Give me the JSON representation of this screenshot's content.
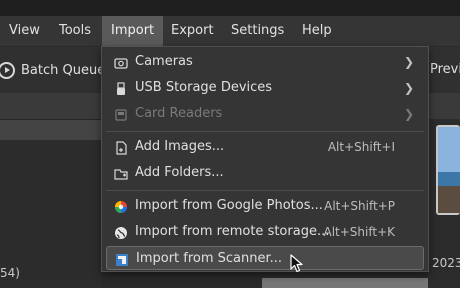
{
  "menubar": {
    "items": [
      "View",
      "Tools",
      "Import",
      "Export",
      "Settings",
      "Help"
    ],
    "active": "Import"
  },
  "toolbar": {
    "batch_queue_label": "Batch Queue",
    "preview_label": "Previ"
  },
  "left_panel": {
    "bottom_text": "54)"
  },
  "right_panel": {
    "date_text": "2023"
  },
  "import_menu": {
    "items": [
      {
        "label": "Cameras",
        "icon": "camera-icon",
        "submenu": true,
        "enabled": true
      },
      {
        "label": "USB Storage Devices",
        "icon": "usb-icon",
        "submenu": true,
        "enabled": true
      },
      {
        "label": "Card Readers",
        "icon": "card-reader-icon",
        "submenu": true,
        "enabled": false
      },
      {
        "label": "Add Images...",
        "icon": "add-image-icon",
        "shortcut": "Alt+Shift+I",
        "enabled": true
      },
      {
        "label": "Add Folders...",
        "icon": "add-folder-icon",
        "enabled": true
      },
      {
        "label": "Import from Google Photos...",
        "icon": "google-photos-icon",
        "shortcut": "Alt+Shift+P",
        "enabled": true
      },
      {
        "label": "Import from remote storage...",
        "icon": "globe-icon",
        "shortcut": "Alt+Shift+K",
        "enabled": true
      },
      {
        "label": "Import from Scanner...",
        "icon": "scanner-icon",
        "enabled": true,
        "hovered": true
      }
    ]
  },
  "colors": {
    "menu_background": "#353535",
    "menu_active": "#5a5a5a",
    "item_hover": "#4a4a4a",
    "text": "#e0e0e0",
    "disabled_text": "#7a7a7a"
  }
}
